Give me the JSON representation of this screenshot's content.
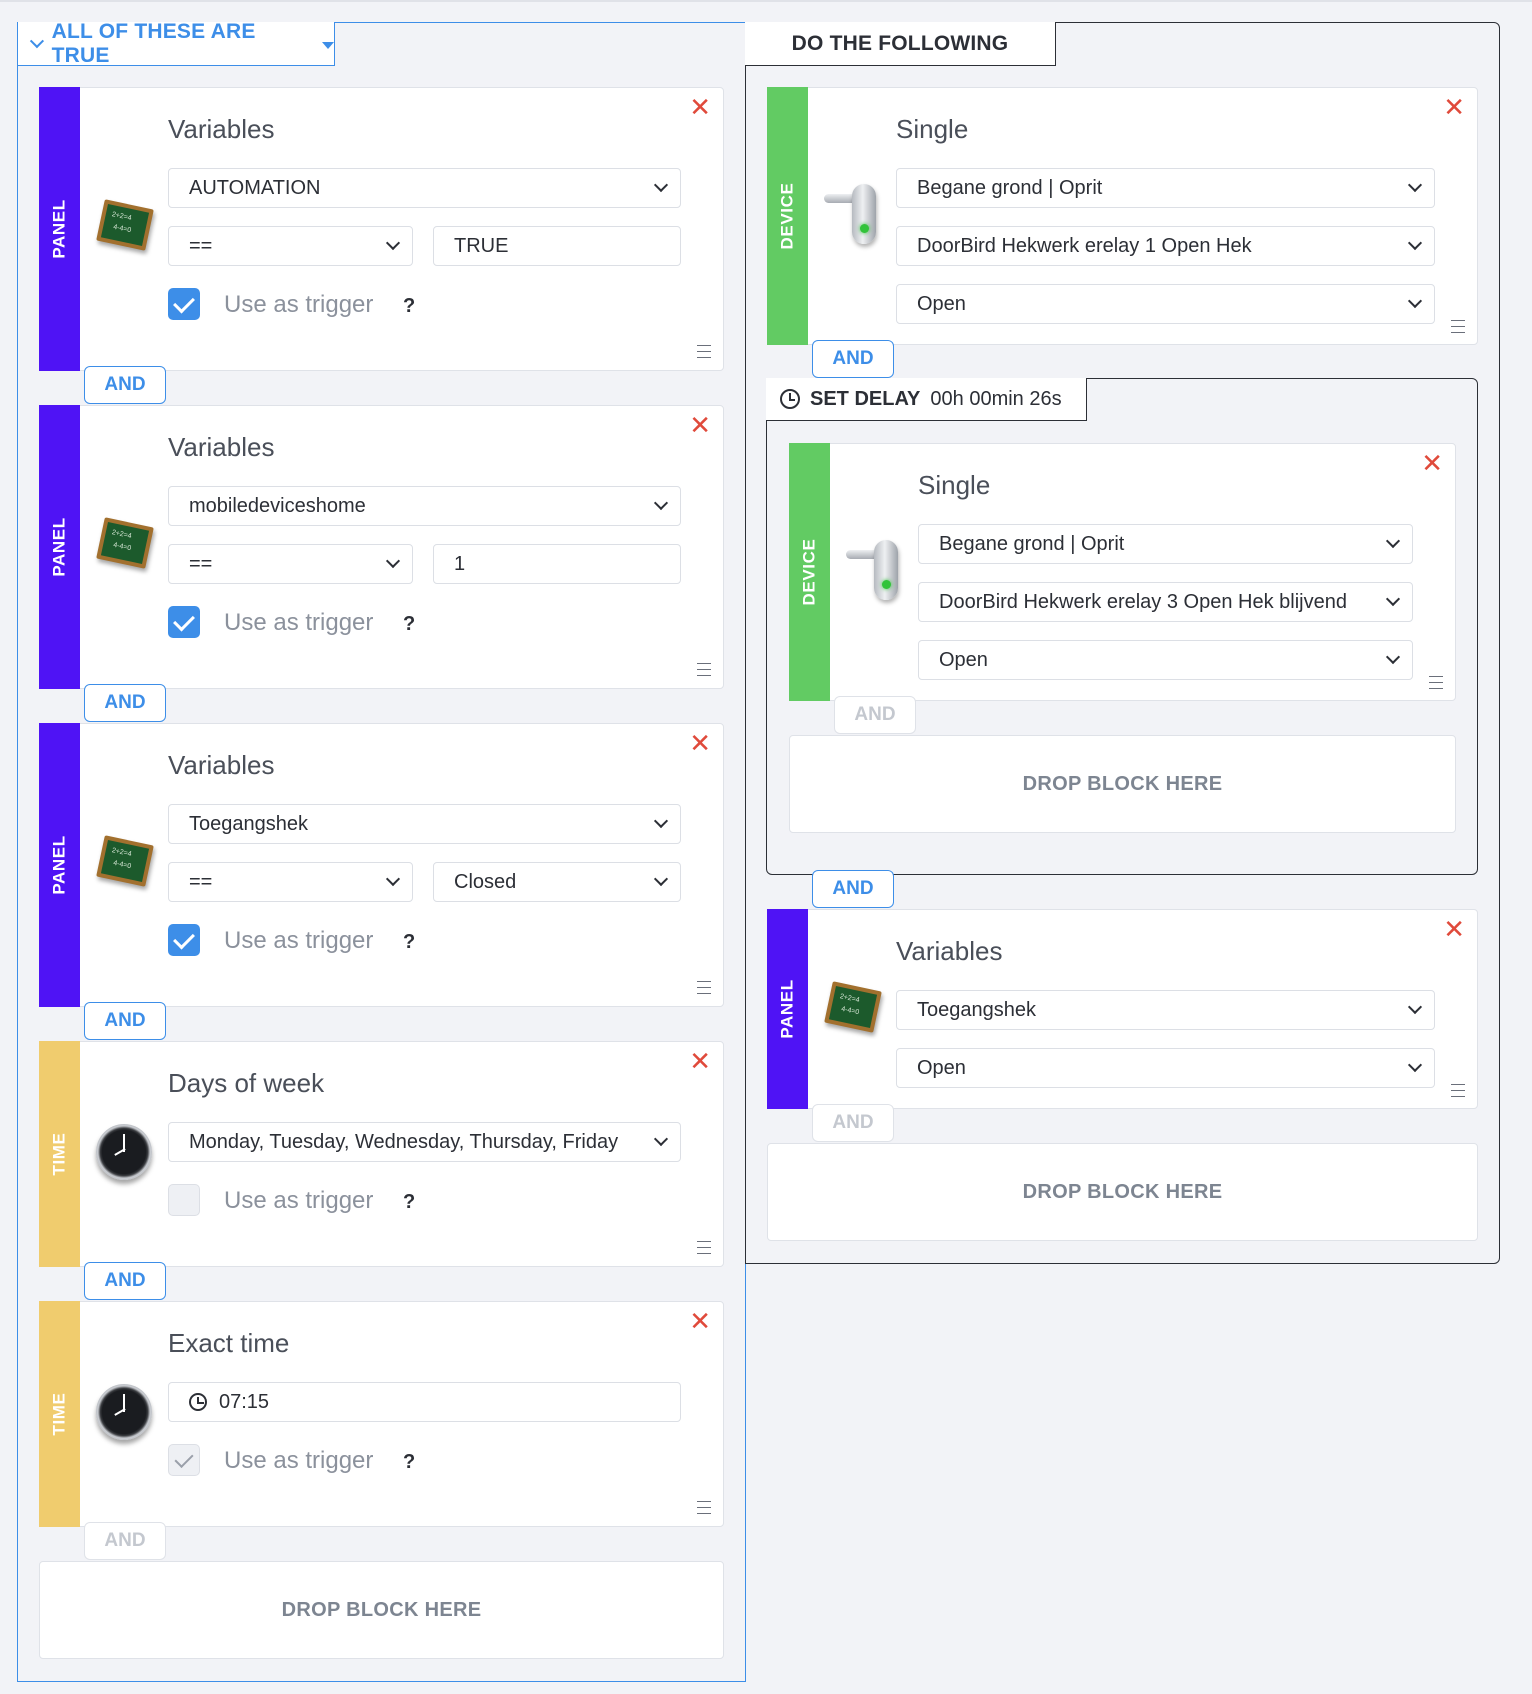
{
  "conditions": {
    "header": "ALL OF THESE ARE TRUE",
    "blocks": [
      {
        "category": "PANEL",
        "title": "Variables",
        "variable": "AUTOMATION",
        "operator": "==",
        "value": "TRUE",
        "trigger_label": "Use as trigger",
        "help": "?"
      },
      {
        "category": "PANEL",
        "title": "Variables",
        "variable": "mobiledeviceshome",
        "operator": "==",
        "value": "1",
        "trigger_label": "Use as trigger",
        "help": "?"
      },
      {
        "category": "PANEL",
        "title": "Variables",
        "variable": "Toegangshek",
        "operator": "==",
        "value": "Closed",
        "trigger_label": "Use as trigger",
        "help": "?"
      },
      {
        "category": "TIME",
        "title": "Days of week",
        "days": "Monday, Tuesday, Wednesday, Thursday, Friday",
        "trigger_label": "Use as trigger",
        "help": "?"
      },
      {
        "category": "TIME",
        "title": "Exact time",
        "time": "07:15",
        "trigger_label": "Use as trigger",
        "help": "?"
      }
    ],
    "and_label": "AND",
    "drop_label": "DROP BLOCK HERE"
  },
  "actions": {
    "header": "DO THE FOLLOWING",
    "device1": {
      "category": "DEVICE",
      "title": "Single",
      "location": "Begane grond | Oprit",
      "device": "DoorBird Hekwerk erelay 1 Open Hek",
      "action": "Open"
    },
    "delay": {
      "label": "SET DELAY",
      "value": "00h 00min 26s"
    },
    "device2": {
      "category": "DEVICE",
      "title": "Single",
      "location": "Begane grond | Oprit",
      "device": "DoorBird Hekwerk erelay 3 Open Hek blijvend",
      "action": "Open"
    },
    "panel": {
      "category": "PANEL",
      "title": "Variables",
      "variable": "Toegangshek",
      "value": "Open"
    },
    "and_label": "AND",
    "drop_label": "DROP BLOCK HERE"
  },
  "colors": {
    "accent": "#3d8ee8",
    "panel": "#4f13f5",
    "device": "#62cb63",
    "time": "#f0cc6e",
    "close": "#e04a3b"
  }
}
